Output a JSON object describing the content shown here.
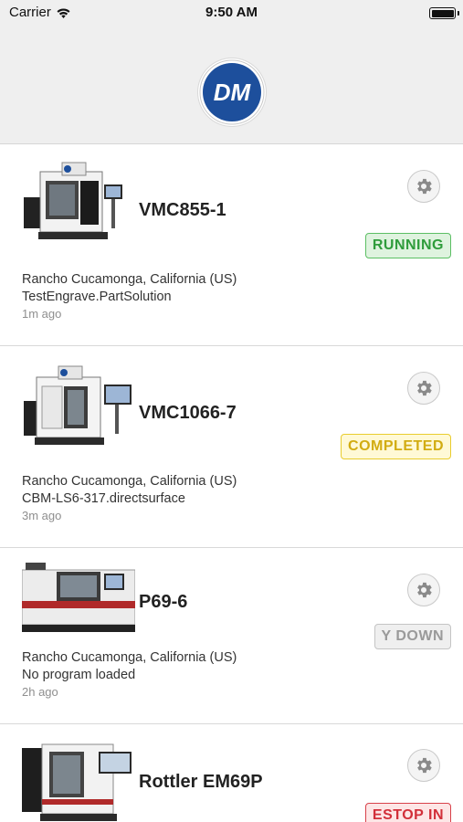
{
  "status_bar": {
    "carrier": "Carrier",
    "time": "9:50 AM"
  },
  "header": {
    "logo_text": "DM"
  },
  "machines": [
    {
      "name": "VMC855-1",
      "status": "RUNNING",
      "location": "Rancho Cucamonga, California (US)",
      "program": "TestEngrave.PartSolution",
      "time_ago": "1m ago"
    },
    {
      "name": "VMC1066-7",
      "status": "COMPLETED",
      "location": "Rancho Cucamonga, California (US)",
      "program": "CBM-LS6-317.directsurface",
      "time_ago": "3m ago"
    },
    {
      "name": "P69-6",
      "status": "Y DOWN",
      "location": "Rancho Cucamonga, California (US)",
      "program": "No program loaded",
      "time_ago": "2h ago"
    },
    {
      "name": "Rottler EM69P",
      "status": "ESTOP IN"
    }
  ],
  "colors": {
    "running": "#2f9c3b",
    "completed": "#d2ac12",
    "y_down": "#9a9a9a",
    "estop": "#d22f39",
    "logo_blue": "#1d4f9c"
  },
  "icons": {
    "settings": "gear-icon",
    "wifi": "wifi-icon",
    "battery": "battery-icon"
  }
}
